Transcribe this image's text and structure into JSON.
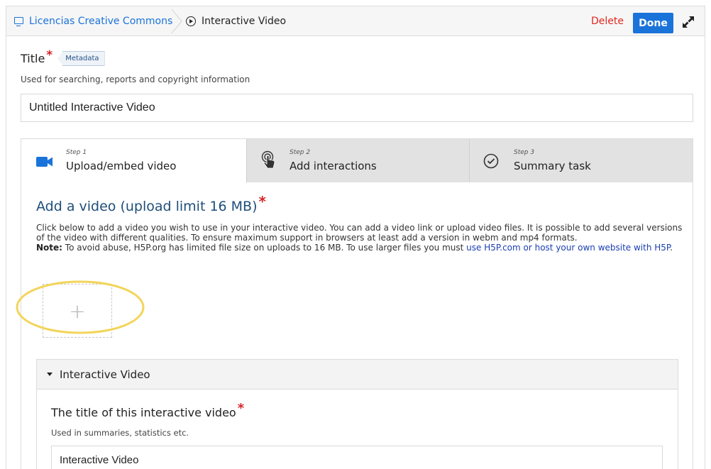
{
  "header": {
    "breadcrumb_root": "Licencias Creative Commons",
    "breadcrumb_current": "Interactive Video",
    "delete_label": "Delete",
    "done_label": "Done"
  },
  "title_field": {
    "label": "Title",
    "required_mark": "*",
    "metadata_label": "Metadata",
    "description": "Used for searching, reports and copyright information",
    "value": "Untitled Interactive Video"
  },
  "steps": [
    {
      "step": "Step 1",
      "name": "Upload/embed video",
      "icon": "video-camera-icon",
      "active": true
    },
    {
      "step": "Step 2",
      "name": "Add interactions",
      "icon": "touch-icon",
      "active": false
    },
    {
      "step": "Step 3",
      "name": "Summary task",
      "icon": "check-circle-icon",
      "active": false
    }
  ],
  "video_section": {
    "heading": "Add a video (upload limit 16 MB)",
    "required_mark": "*",
    "instructions": "Click below to add a video you wish to use in your interactive video. You can add a video link or upload video files. It is possible to add several versions of the video with different qualities. To ensure maximum support in browsers at least add a version in webm and mp4 formats.",
    "note_label": "Note:",
    "note_text": " To avoid abuse, H5P.org has limited file size on uploads to 16 MB. To use larger files you must ",
    "note_link": "use H5P.com or host your own website with H5P",
    "note_end": ".",
    "add_symbol": "+"
  },
  "interactive_video": {
    "section_label": "Interactive Video",
    "field_label": "The title of this interactive video",
    "required_mark": "*",
    "description": "Used in summaries, statistics etc.",
    "value": "Interactive Video"
  },
  "colors": {
    "accent": "#1a73d9",
    "delete": "#e0271e",
    "required": "#d4252a",
    "heading": "#1f4e7a",
    "highlight": "#f2d55a"
  }
}
